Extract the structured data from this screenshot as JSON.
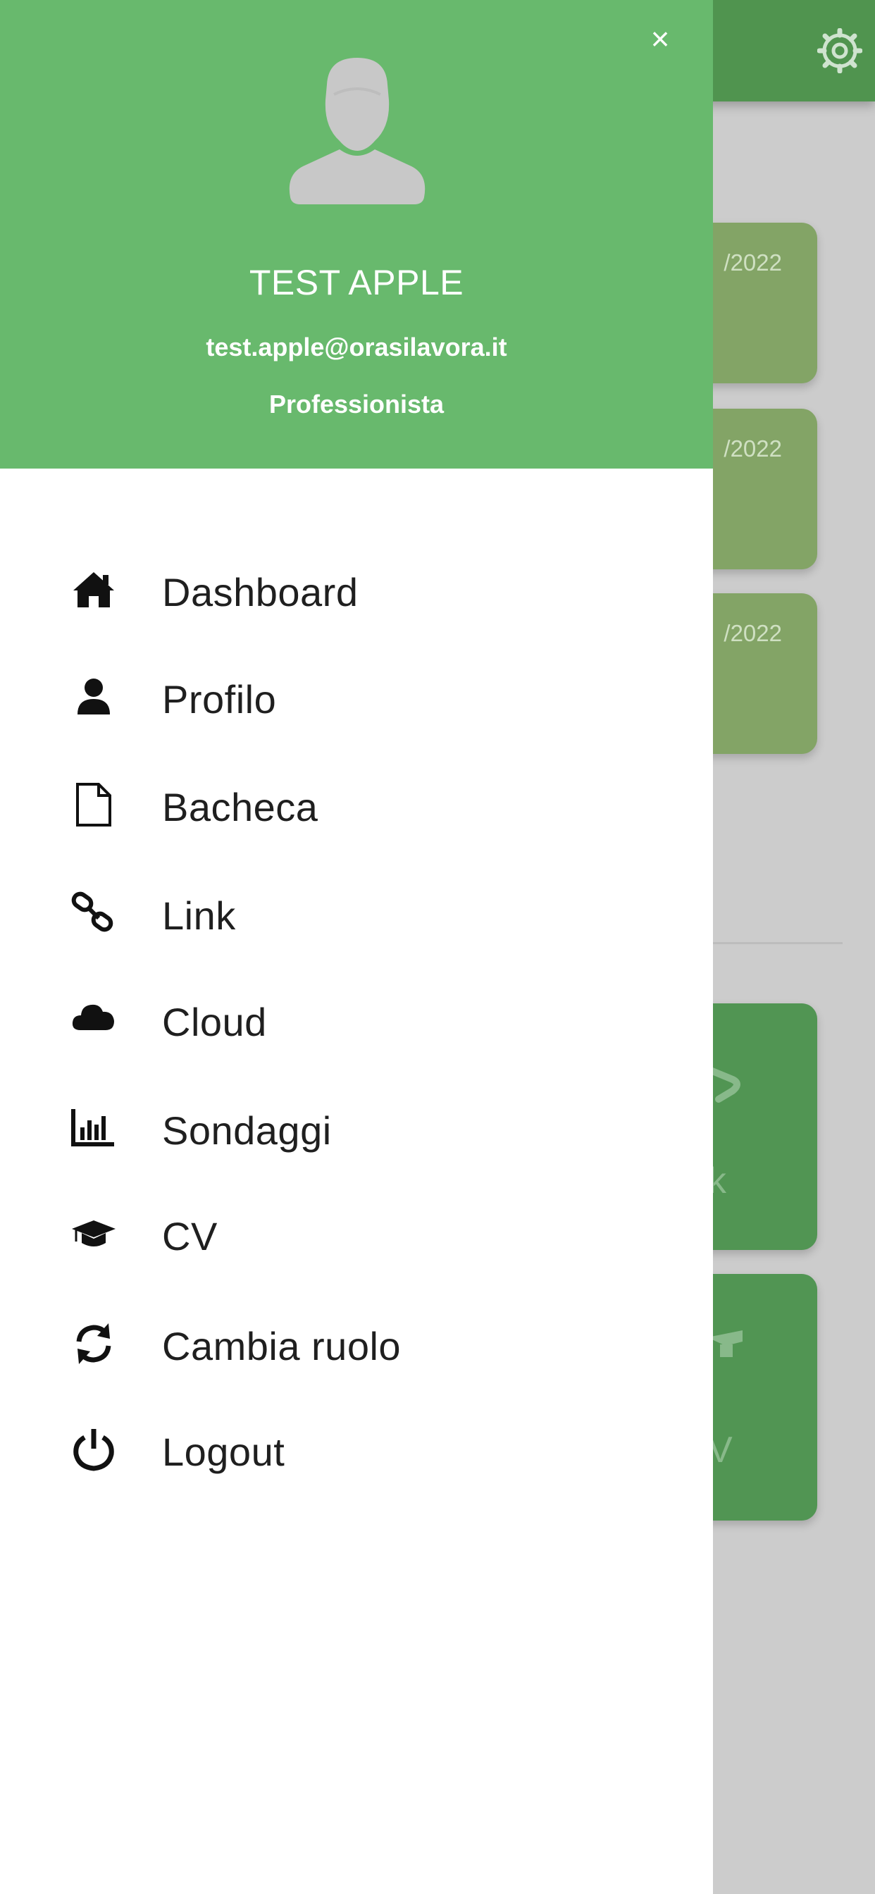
{
  "background": {
    "cards": [
      {
        "date": "/2022"
      },
      {
        "date": "/2022"
      },
      {
        "date": "/2022"
      }
    ],
    "tiles": [
      {
        "label": "k"
      },
      {
        "label": "V"
      }
    ]
  },
  "drawer": {
    "close_label": "×",
    "user": {
      "name": "TEST APPLE",
      "email": "test.apple@orasilavora.it",
      "role": "Professionista"
    },
    "menu": [
      {
        "label": "Dashboard",
        "icon": "home-icon"
      },
      {
        "label": "Profilo",
        "icon": "user-icon"
      },
      {
        "label": "Bacheca",
        "icon": "file-icon"
      },
      {
        "label": "Link",
        "icon": "link-icon"
      },
      {
        "label": "Cloud",
        "icon": "cloud-icon"
      },
      {
        "label": "Sondaggi",
        "icon": "bar-chart-icon"
      },
      {
        "label": "CV",
        "icon": "graduation-cap-icon"
      },
      {
        "label": "Cambia ruolo",
        "icon": "refresh-icon"
      },
      {
        "label": "Logout",
        "icon": "power-icon"
      }
    ]
  },
  "colors": {
    "drawer_header": "#68b96d",
    "app_header": "#50944f",
    "card": "#83a466",
    "tile": "#519553",
    "overlay": "#cccccc"
  }
}
